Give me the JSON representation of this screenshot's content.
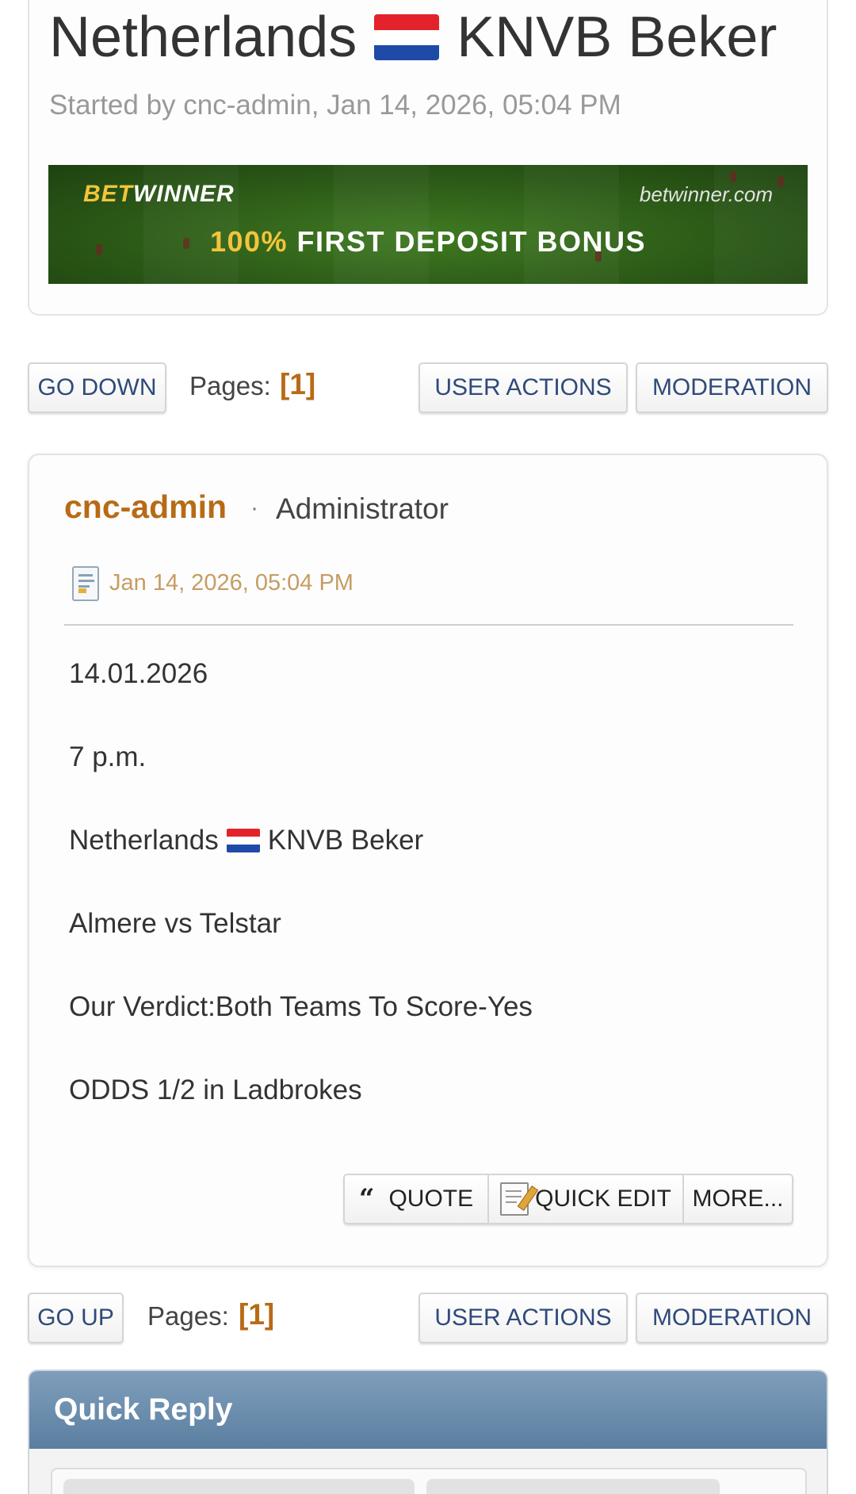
{
  "topic": {
    "title_left": "Netherlands",
    "title_flag_icon": "netherlands-flag-icon",
    "title_right": "KNVB Beker",
    "started_by": "Started by cnc-admin, Jan 14, 2026, 05:04 PM"
  },
  "banner": {
    "brand_bet": "BET",
    "brand_winner": "WINNER",
    "site": "betwinner.com",
    "offer_percent": "100%",
    "offer_text": "FIRST DEPOSIT BONUS",
    "colors": {
      "accent": "#f3c43a",
      "field": "#2c5a17"
    }
  },
  "nav_top": {
    "go_down": "GO DOWN",
    "pages_label": "Pages:",
    "pages_current": "[1]",
    "user_actions": "USER ACTIONS",
    "moderation": "MODERATION"
  },
  "post": {
    "author": "cnc-admin",
    "separator": "·",
    "role": "Administrator",
    "post_icon": "post-document-icon",
    "date": "Jan 14, 2026, 05:04 PM",
    "lines": {
      "date": "14.01.2026",
      "time": "7 p.m.",
      "league_left": "Netherlands",
      "league_right": "KNVB Beker",
      "match": "Almere vs Telstar",
      "verdict": "Our Verdict:Both Teams To Score-Yes",
      "odds": "ODDS 1/2 in Ladbrokes"
    },
    "actions": {
      "quote_icon": "“",
      "quote": "QUOTE",
      "quick_edit_icon": "edit-note-icon",
      "quick_edit": "QUICK EDIT",
      "more": "MORE..."
    }
  },
  "nav_bottom": {
    "go_up": "GO UP",
    "pages_label": "Pages:",
    "pages_current": "[1]",
    "user_actions": "USER ACTIONS",
    "moderation": "MODERATION"
  },
  "quick_reply": {
    "title": "Quick Reply",
    "header_color": "#5b7fa1"
  },
  "colors": {
    "link_accent": "#b76b16",
    "button_text": "#2f4a7a",
    "date_text": "#c69c63"
  }
}
